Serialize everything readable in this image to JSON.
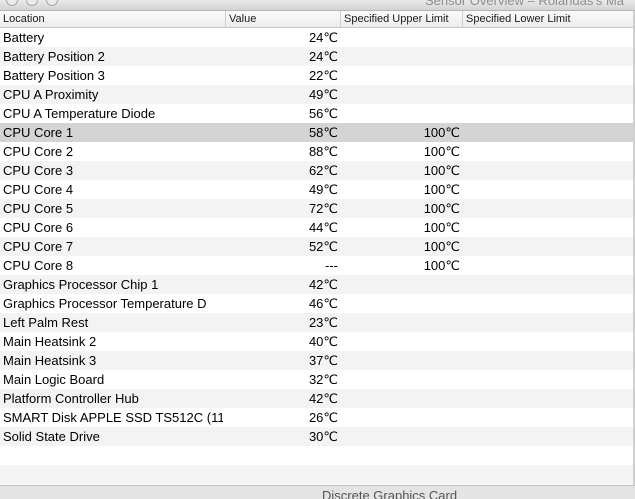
{
  "window": {
    "title": "Sensor Overview – Rolandas's Ma"
  },
  "columns": {
    "location": "Location",
    "value": "Value",
    "upper": "Specified Upper Limit",
    "lower": "Specified Lower Limit"
  },
  "rows": [
    {
      "location": "Battery",
      "value": "24℃",
      "upper": "",
      "lower": ""
    },
    {
      "location": "Battery Position 2",
      "value": "24℃",
      "upper": "",
      "lower": ""
    },
    {
      "location": "Battery Position 3",
      "value": "22℃",
      "upper": "",
      "lower": ""
    },
    {
      "location": "CPU A Proximity",
      "value": "49℃",
      "upper": "",
      "lower": ""
    },
    {
      "location": "CPU A Temperature Diode",
      "value": "56℃",
      "upper": "",
      "lower": ""
    },
    {
      "location": "CPU Core 1",
      "value": "58℃",
      "upper": "100℃",
      "lower": ""
    },
    {
      "location": "CPU Core 2",
      "value": "88℃",
      "upper": "100℃",
      "lower": ""
    },
    {
      "location": "CPU Core 3",
      "value": "62℃",
      "upper": "100℃",
      "lower": ""
    },
    {
      "location": "CPU Core 4",
      "value": "49℃",
      "upper": "100℃",
      "lower": ""
    },
    {
      "location": "CPU Core 5",
      "value": "72℃",
      "upper": "100℃",
      "lower": ""
    },
    {
      "location": "CPU Core 6",
      "value": "44℃",
      "upper": "100℃",
      "lower": ""
    },
    {
      "location": "CPU Core 7",
      "value": "52℃",
      "upper": "100℃",
      "lower": ""
    },
    {
      "location": "CPU Core 8",
      "value": "---",
      "upper": "100℃",
      "lower": ""
    },
    {
      "location": "Graphics Processor Chip 1",
      "value": "42℃",
      "upper": "",
      "lower": ""
    },
    {
      "location": "Graphics Processor Temperature D",
      "value": "46℃",
      "upper": "",
      "lower": ""
    },
    {
      "location": "Left Palm Rest",
      "value": "23℃",
      "upper": "",
      "lower": ""
    },
    {
      "location": "Main Heatsink 2",
      "value": "40℃",
      "upper": "",
      "lower": ""
    },
    {
      "location": "Main Heatsink 3",
      "value": "37℃",
      "upper": "",
      "lower": ""
    },
    {
      "location": "Main Logic Board",
      "value": "32℃",
      "upper": "",
      "lower": ""
    },
    {
      "location": "Platform Controller Hub",
      "value": "42℃",
      "upper": "",
      "lower": ""
    },
    {
      "location": "SMART Disk APPLE SSD TS512C (11",
      "value": "26℃",
      "upper": "",
      "lower": ""
    },
    {
      "location": "Solid State Drive",
      "value": "30℃",
      "upper": "",
      "lower": ""
    }
  ],
  "selected_row": "CPU Core 1",
  "behind_window_text": "Discrete Graphics Card"
}
